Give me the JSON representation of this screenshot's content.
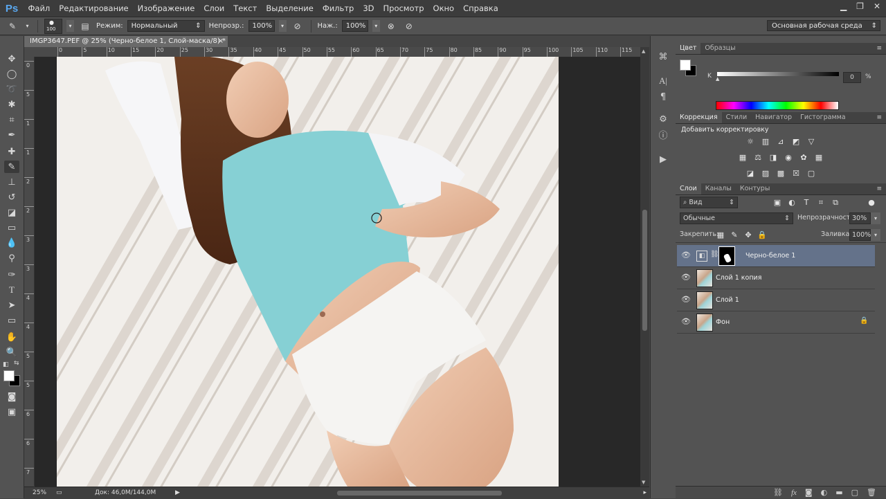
{
  "app": {
    "logo": "Ps"
  },
  "menu": [
    "Файл",
    "Редактирование",
    "Изображение",
    "Слои",
    "Текст",
    "Выделение",
    "Фильтр",
    "3D",
    "Просмотр",
    "Окно",
    "Справка"
  ],
  "window_controls": {
    "minimize": "▁",
    "restore": "❐",
    "close": "✕"
  },
  "options": {
    "brush_size": "100",
    "mode_label": "Режим:",
    "mode_value": "Нормальный",
    "opacity_label": "Непрозр.:",
    "opacity_value": "100%",
    "flow_label": "Наж.:",
    "flow_value": "100%",
    "workspace": "Основная рабочая среда"
  },
  "document": {
    "tab_title": "IMGP3647.PEF @ 25% (Черно-белое 1, Слой-маска/8) *",
    "zoom": "25%",
    "doc_info": "Док: 46,0M/144,0M"
  },
  "rulers": {
    "h_labels": [
      "0",
      "5",
      "10",
      "15",
      "20",
      "25",
      "30",
      "35",
      "40",
      "45",
      "50",
      "55",
      "60",
      "65",
      "70",
      "75",
      "80",
      "85",
      "90",
      "95",
      "100",
      "105",
      "110",
      "115"
    ],
    "v_labels": [
      "0",
      "5",
      "1",
      "1",
      "2",
      "2",
      "3",
      "3",
      "4",
      "4",
      "5",
      "5",
      "6",
      "6",
      "7"
    ]
  },
  "color_panel": {
    "tabs": [
      "Цвет",
      "Образцы"
    ],
    "channel_label": "K",
    "channel_value": "0",
    "percent": "%"
  },
  "adjustments_panel": {
    "tabs": [
      "Коррекция",
      "Стили",
      "Навигатор",
      "Гистограмма"
    ],
    "title": "Добавить корректировку"
  },
  "layers_panel": {
    "tabs": [
      "Слои",
      "Каналы",
      "Контуры"
    ],
    "filter_label": "Вид",
    "blend_mode": "Обычные",
    "opacity_label": "Непрозрачность:",
    "opacity_value": "30%",
    "lock_label": "Закрепить:",
    "fill_label": "Заливка:",
    "fill_value": "100%",
    "layers": [
      {
        "name": "Черно-белое 1",
        "selected": true
      },
      {
        "name": "Слой 1 копия",
        "selected": false
      },
      {
        "name": "Слой 1",
        "selected": false
      },
      {
        "name": "Фон",
        "selected": false,
        "locked": true
      }
    ]
  },
  "colors": {
    "accent": "#5aa8f0",
    "selected_layer": "#64728a",
    "foreground": "#ffffff",
    "background": "#000000"
  }
}
